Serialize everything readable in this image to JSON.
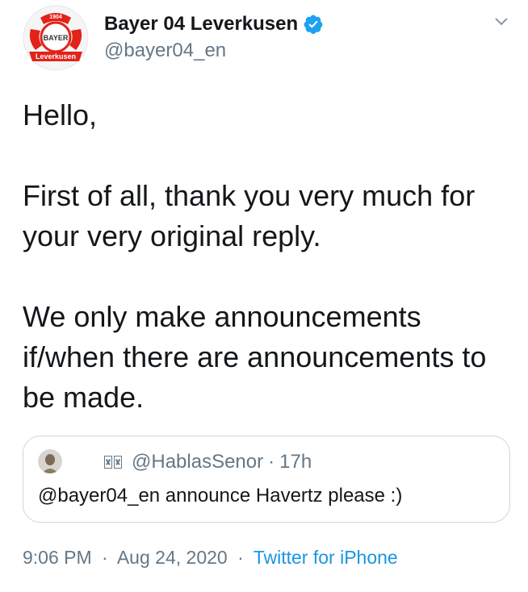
{
  "author": {
    "display_name": "Bayer 04 Leverkusen",
    "handle": "@bayer04_en",
    "verified": true,
    "avatar_icon": "bayer04-crest-icon",
    "avatar_crest_text": {
      "year": "1904",
      "center": "BAYER",
      "ribbon": "Leverkusen"
    }
  },
  "tweet": {
    "text": "Hello,\n\nFirst of all, thank you very much for your very original reply.\n\nWe only make announcements if/when there are announcements to be made."
  },
  "quoted_tweet": {
    "author_name_glyphs": "𝓜𝓒",
    "handle": "@HablasSenor",
    "separator": "·",
    "time": "17h",
    "text": "@bayer04_en announce Havertz please :)"
  },
  "footer": {
    "time": "9:06 PM",
    "separator1": "·",
    "date": "Aug 24, 2020",
    "separator2": "·",
    "source": "Twitter for iPhone"
  },
  "colors": {
    "text_primary": "#14171a",
    "text_secondary": "#657786",
    "link_blue": "#1b95e0",
    "verified_blue": "#1da1f2",
    "crest_red": "#e32219",
    "card_border": "#ccd6dd"
  }
}
